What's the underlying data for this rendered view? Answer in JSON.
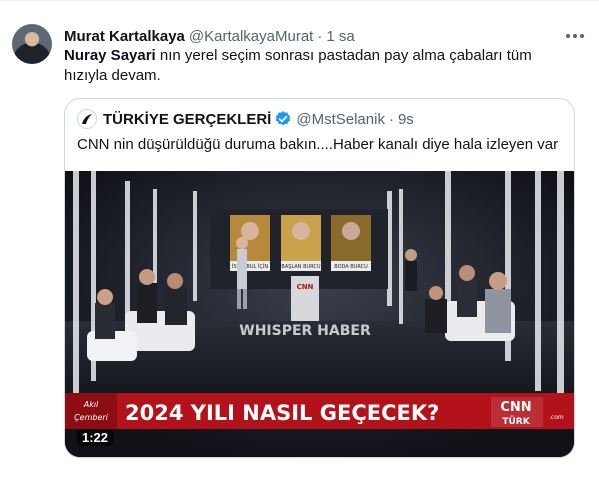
{
  "author": {
    "name": "Murat Kartalkaya",
    "handle": "@KartalkayaMurat",
    "separator": "·",
    "time": "1 sa",
    "icon": "avatar-photo"
  },
  "tweet": {
    "mention": "Nuray Sayari",
    "text_rest": " nın yerel seçim sonrası pastadan pay alma çabaları tüm hızıyla devam."
  },
  "quote": {
    "name": "TÜRKİYE GERÇEKLERİ",
    "handle": "@MstSelanik",
    "separator": "·",
    "time": "9s",
    "text": "CNN nin düşürüldüğü duruma bakın....Haber kanalı diye hala izleyen var",
    "verified_color": "#1d9bf0"
  },
  "video": {
    "duration": "1:22",
    "banner_left_line1": "Akıl",
    "banner_left_line2": "Çemberi",
    "banner_title": "2024 YILI NASIL GEÇECEK?",
    "channel_logo_top": "CNN",
    "channel_logo_bottom": "TÜRK",
    "channel_logo_side": ".com",
    "watermark": "WHISPER HABER",
    "screen_caption_1": "İSTANBUL İÇİN",
    "screen_caption_2": "BAŞLAN BURCU",
    "screen_caption_3": "BODA BURCU",
    "desk_logo": "CNN"
  },
  "colors": {
    "banner_red": "#b3121a",
    "accent": "#1d9bf0"
  }
}
